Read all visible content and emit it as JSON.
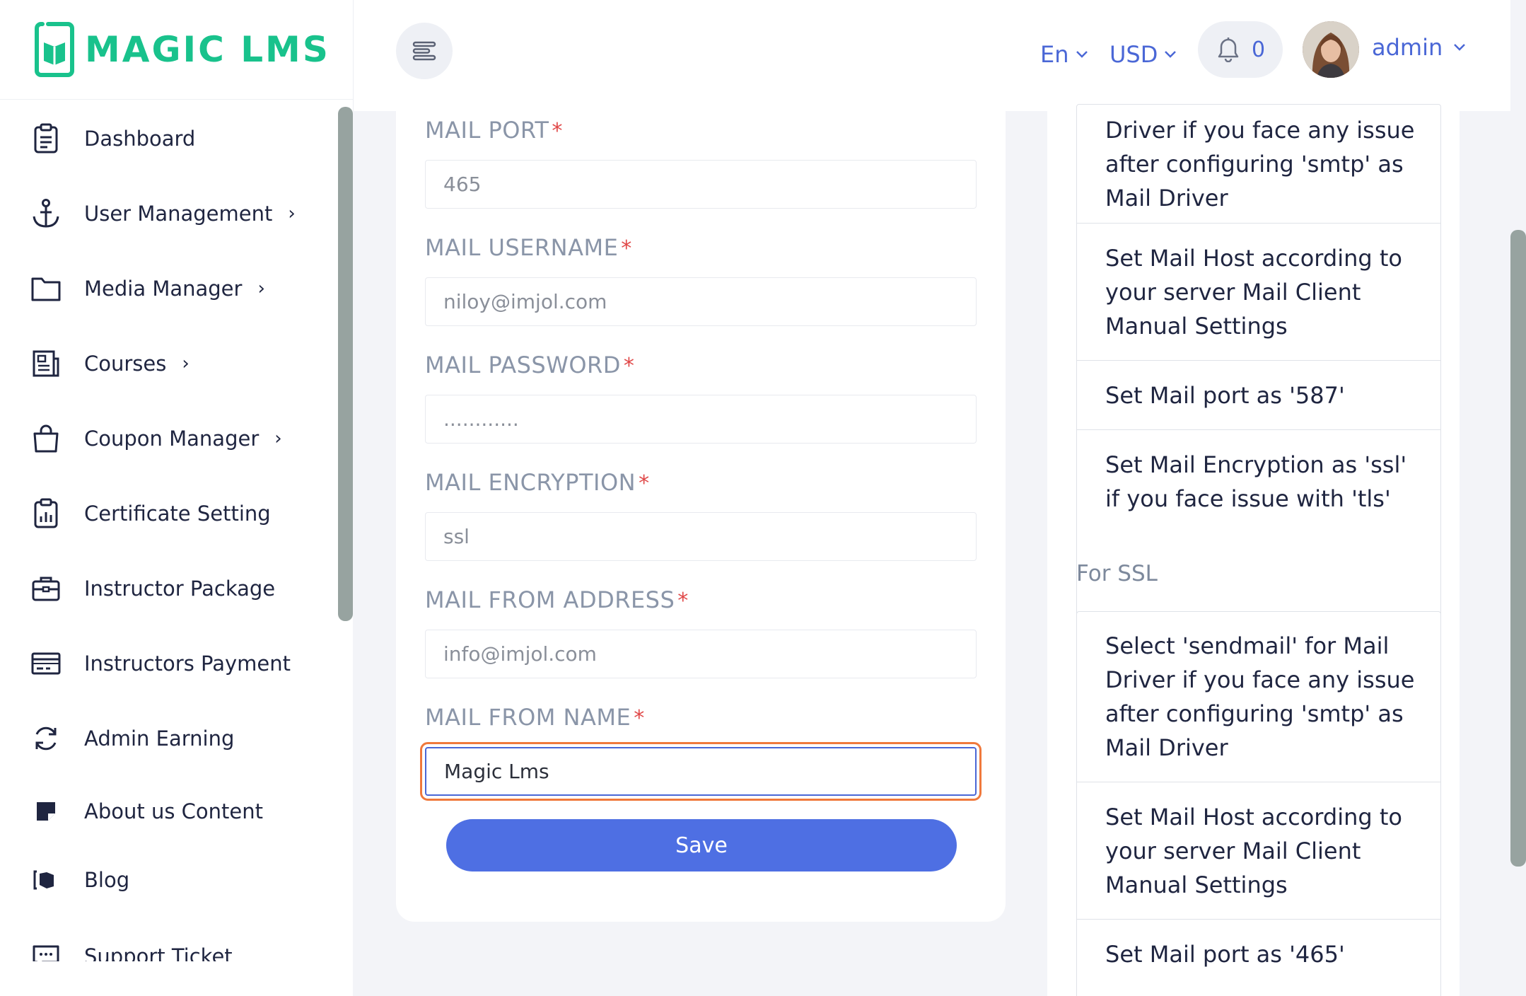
{
  "brand": {
    "name": "MAGIC LMS",
    "color": "#19c28c"
  },
  "accent": "#4e6fe3",
  "header": {
    "language": "En",
    "currency": "USD",
    "notification_count": "0",
    "user_name": "admin"
  },
  "sidebar": {
    "items": [
      {
        "label": "Dashboard",
        "icon": "clipboard-icon",
        "has_submenu": false
      },
      {
        "label": "User Management",
        "icon": "anchor-icon",
        "has_submenu": true
      },
      {
        "label": "Media Manager",
        "icon": "folder-icon",
        "has_submenu": true
      },
      {
        "label": "Courses",
        "icon": "newspaper-icon",
        "has_submenu": true
      },
      {
        "label": "Coupon Manager",
        "icon": "shopping-bag-icon",
        "has_submenu": true
      },
      {
        "label": "Certificate Setting",
        "icon": "clipboard-chart-icon",
        "has_submenu": false
      },
      {
        "label": "Instructor Package",
        "icon": "briefcase-icon",
        "has_submenu": false
      },
      {
        "label": "Instructors Payment",
        "icon": "credit-card-icon",
        "has_submenu": false
      },
      {
        "label": "Admin Earning",
        "icon": "refresh-icon",
        "has_submenu": false
      },
      {
        "label": "About us Content",
        "icon": "sticky-note-icon",
        "has_submenu": false
      },
      {
        "label": "Blog",
        "icon": "blog-icon",
        "has_submenu": false
      },
      {
        "label": "Support Ticket",
        "icon": "chat-icon",
        "has_submenu": false
      }
    ]
  },
  "form": {
    "fields": [
      {
        "label": "MAIL PORT",
        "value": "465"
      },
      {
        "label": "MAIL USERNAME",
        "value": "niloy@imjol.com"
      },
      {
        "label": "MAIL PASSWORD",
        "value": "............"
      },
      {
        "label": "MAIL ENCRYPTION",
        "value": "ssl"
      },
      {
        "label": "MAIL FROM ADDRESS",
        "value": "info@imjol.com"
      },
      {
        "label": "MAIL FROM NAME",
        "value": "Magic Lms"
      }
    ],
    "required_mark": "*",
    "save_label": "Save"
  },
  "help": {
    "tls_box": [
      "Driver if you face any issue after configuring 'smtp' as Mail Driver",
      "Set Mail Host according to your server Mail Client Manual Settings",
      "Set Mail port as '587'",
      "Set Mail Encryption as 'ssl' if you face issue with 'tls'"
    ],
    "ssl_heading": "For SSL",
    "ssl_box": [
      "Select 'sendmail' for Mail Driver if you face any issue after configuring 'smtp' as Mail Driver",
      "Set Mail Host according to your server Mail Client Manual Settings",
      "Set Mail port as '465'"
    ]
  }
}
